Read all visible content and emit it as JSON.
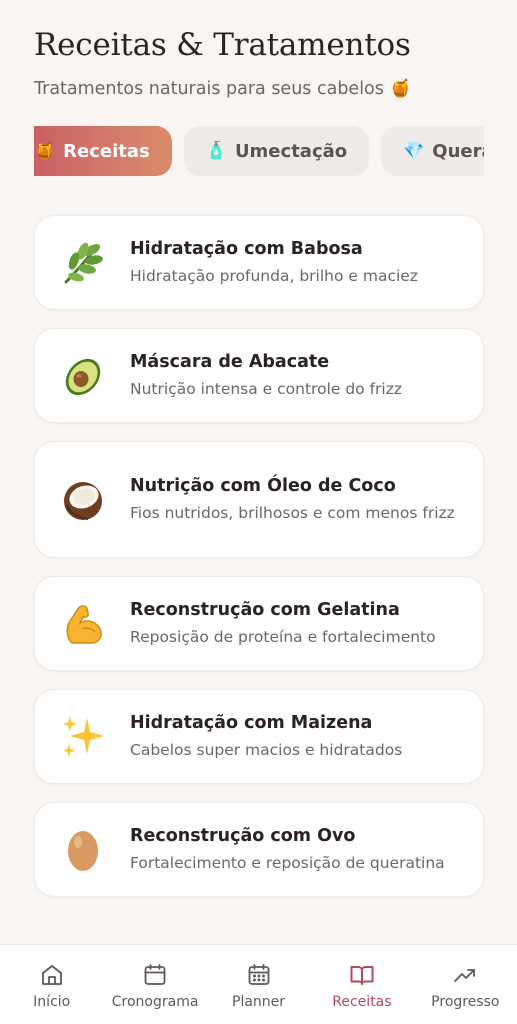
{
  "header": {
    "title": "Receitas & Tratamentos",
    "subtitle": "Tratamentos naturais para seus cabelos",
    "subtitle_emoji": "🍯"
  },
  "tabs": [
    {
      "label": "Receitas",
      "icon": "🍯",
      "active": true
    },
    {
      "label": "Umectação",
      "icon": "🧴",
      "active": false
    },
    {
      "label": "Queratin",
      "icon": "💎",
      "active": false
    }
  ],
  "recipes": [
    {
      "title": "Hidratação com Babosa",
      "description": "Hidratação profunda, brilho e maciez",
      "icon": "herb-icon"
    },
    {
      "title": "Máscara de Abacate",
      "description": "Nutrição intensa e controle do frizz",
      "icon": "avocado-icon"
    },
    {
      "title": "Nutrição com Óleo de Coco",
      "description": "Fios nutridos, brilhosos e com menos frizz",
      "icon": "coconut-icon"
    },
    {
      "title": "Reconstrução com Gelatina",
      "description": "Reposição de proteína e fortalecimento",
      "icon": "flexed-biceps-icon"
    },
    {
      "title": "Hidratação com Maizena",
      "description": "Cabelos super macios e hidratados",
      "icon": "sparkles-icon"
    },
    {
      "title": "Reconstrução com Ovo",
      "description": "Fortalecimento e reposição de queratina",
      "icon": "egg-icon"
    }
  ],
  "nav": [
    {
      "label": "Início",
      "icon": "home-icon",
      "active": false
    },
    {
      "label": "Cronograma",
      "icon": "calendar-icon",
      "active": false
    },
    {
      "label": "Planner",
      "icon": "calendar-grid-icon",
      "active": false
    },
    {
      "label": "Receitas",
      "icon": "book-open-icon",
      "active": true
    },
    {
      "label": "Progresso",
      "icon": "trending-up-icon",
      "active": false
    }
  ],
  "colors": {
    "accent": "#b3485e",
    "tab_gradient_start": "#c85b63",
    "tab_gradient_end": "#d98d6a",
    "background": "#f8f5f3"
  }
}
